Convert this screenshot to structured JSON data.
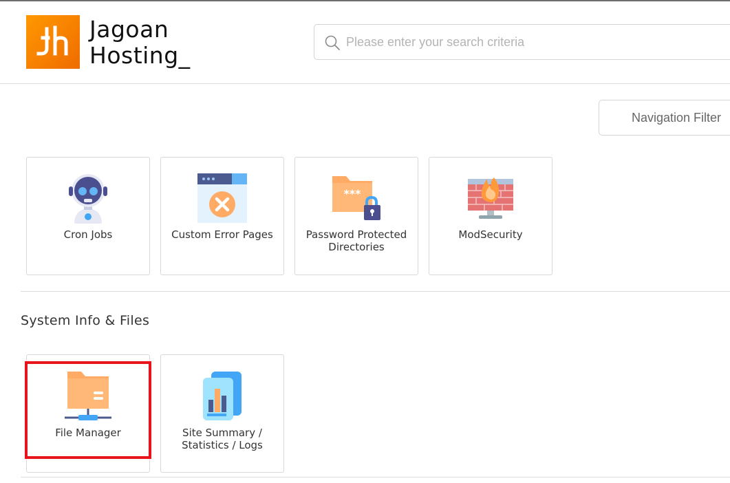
{
  "brand": {
    "line1": "Jagoan",
    "line2": "Hosting_",
    "accent_color": "#f57c00"
  },
  "search": {
    "placeholder": "Please enter your search criteria",
    "icon": "search-icon"
  },
  "nav_filter": {
    "label": "Navigation Filter"
  },
  "security_tools": [
    {
      "label": "Cron Jobs",
      "icon": "robot-icon"
    },
    {
      "label": "Custom Error Pages",
      "icon": "error-page-icon"
    },
    {
      "label": "Password Protected Directories",
      "icon": "locked-folder-icon"
    },
    {
      "label": "ModSecurity",
      "icon": "firewall-icon"
    }
  ],
  "system_section": {
    "title": "System Info & Files",
    "tools": [
      {
        "label": "File Manager",
        "icon": "file-manager-icon"
      },
      {
        "label": "Site Summary / Statistics / Logs",
        "icon": "statistics-icon"
      }
    ]
  },
  "highlight_color": "#e8141b"
}
